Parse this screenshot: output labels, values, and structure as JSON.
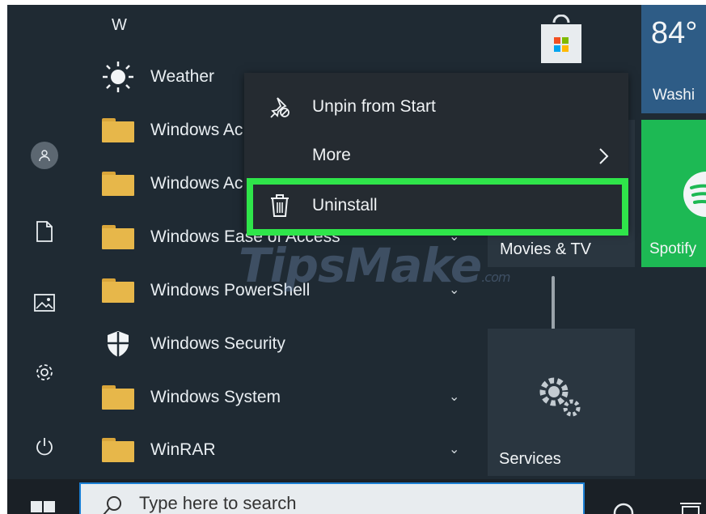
{
  "applist": {
    "letter": "W",
    "apps": [
      {
        "label": "Weather",
        "icon": "sun-icon"
      },
      {
        "label": "Windows Ac",
        "icon": "folder-icon"
      },
      {
        "label": "Windows Ac",
        "icon": "folder-icon"
      },
      {
        "label": "Windows Ease of Access",
        "icon": "folder-icon"
      },
      {
        "label": "Windows PowerShell",
        "icon": "folder-icon"
      },
      {
        "label": "Windows Security",
        "icon": "shield-icon"
      },
      {
        "label": "Windows System",
        "icon": "folder-icon"
      },
      {
        "label": "WinRAR",
        "icon": "folder-icon"
      }
    ]
  },
  "context_menu": {
    "items": [
      {
        "label": "Unpin from Start",
        "icon": "unpin-icon"
      },
      {
        "label": "More",
        "icon": "chevron-right-icon"
      },
      {
        "label": "Uninstall",
        "icon": "trash-icon"
      }
    ],
    "highlight_color": "#2fe54a"
  },
  "tiles": {
    "weather_temp": "84°",
    "weather_city": "Washi",
    "movies": "Movies & TV",
    "spotify": "Spotify",
    "services": "Services"
  },
  "taskbar": {
    "search_placeholder": "Type here to search"
  },
  "watermark": {
    "text": "TipsMake",
    "suffix": ".com"
  },
  "colors": {
    "start_bg": "#1f2a33",
    "menu_bg": "#252b31",
    "weather_tile": "#2e5c86",
    "spotify_tile": "#1db954",
    "folder": "#e7b74a",
    "search_border": "#1b7fd4"
  }
}
